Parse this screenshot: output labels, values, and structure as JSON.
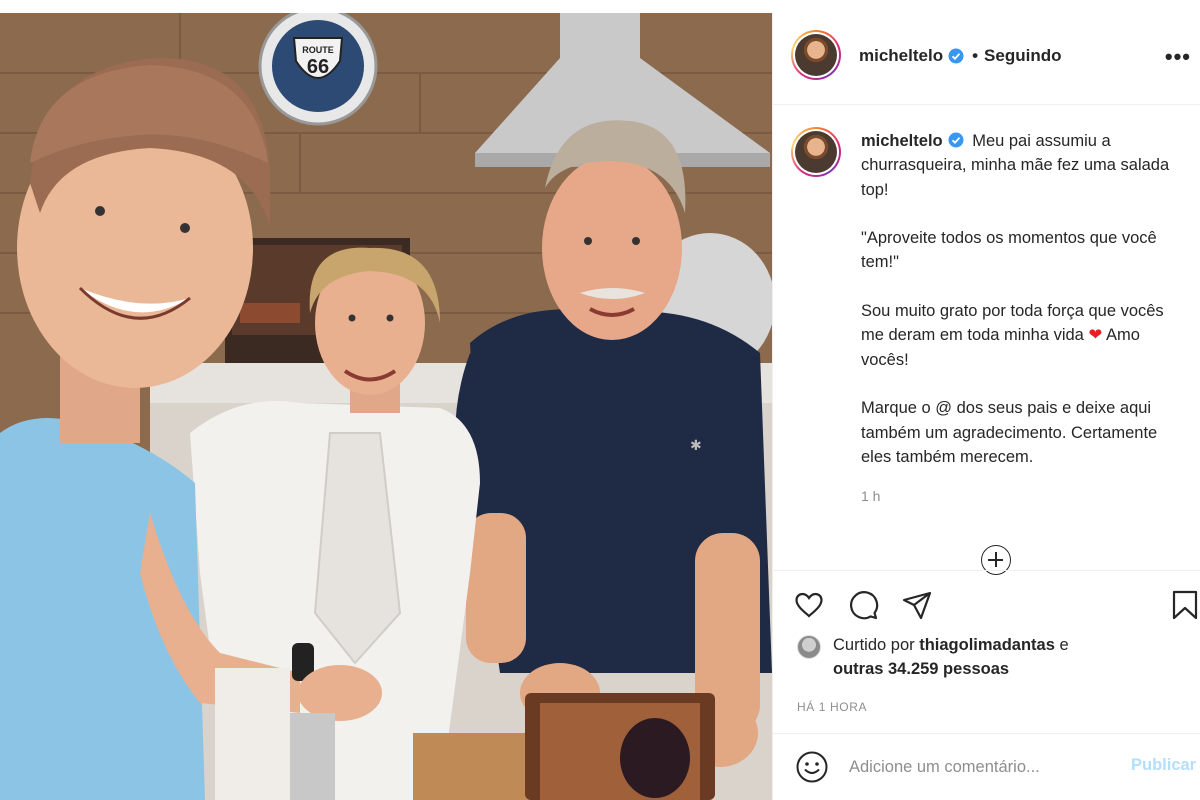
{
  "photo": {
    "sign_route": "ROUTE",
    "sign_number": "66"
  },
  "header": {
    "username": "micheltelo",
    "separator": "•",
    "follow_status": "Seguindo",
    "more": "•••"
  },
  "caption": {
    "username": "micheltelo",
    "line1": "Meu pai assumiu a churrasqueira, minha mãe fez uma salada top!",
    "line2": "\"Aproveite todos os momentos que você tem!\"",
    "line3": "Sou muito grato por toda força que vocês me deram em toda minha vida",
    "heart": "❤",
    "line3_end": "Amo vocês!",
    "line4": "Marque o @ dos seus pais e deixe aqui também um agradecimento. Certamente eles também merecem.",
    "time_ago": "1 h"
  },
  "likes": {
    "prefix": "Curtido por",
    "user": "thiagolimadantas",
    "suffix": "e",
    "others": "outras 34.259 pessoas"
  },
  "post_time": "HÁ 1 HORA",
  "comment": {
    "placeholder": "Adicione um comentário...",
    "publish": "Publicar"
  },
  "colors": {
    "verified": "#3897f0",
    "publish_disabled": "#b2dffc",
    "heart": "#ed1c24"
  }
}
